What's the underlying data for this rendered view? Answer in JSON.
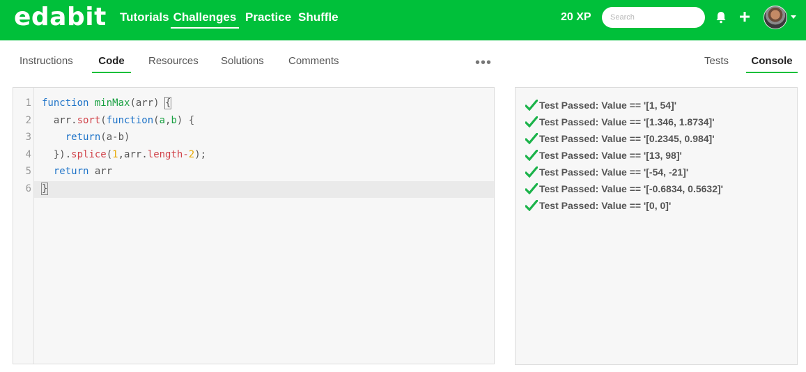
{
  "navbar": {
    "logo": "edabit",
    "links": [
      "Tutorials",
      "Challenges",
      "Practice",
      "Shuffle"
    ],
    "active_link": "Challenges",
    "xp": "20 XP",
    "search_placeholder": "Search",
    "icons": [
      "bell-icon",
      "plus-icon",
      "avatar",
      "chevron-down-icon"
    ]
  },
  "tabs": {
    "left": [
      "Instructions",
      "Code",
      "Resources",
      "Solutions",
      "Comments"
    ],
    "active_left": "Code",
    "more": "•••",
    "right": [
      "Tests",
      "Console"
    ],
    "active_right": "Console"
  },
  "editor": {
    "line_numbers": [
      "1",
      "2",
      "3",
      "4",
      "5",
      "6"
    ],
    "lines": [
      "function minMax(arr) {",
      "  arr.sort(function(a,b) {",
      "    return(a-b)",
      "  }).splice(1,arr.length-2);",
      "  return arr",
      "}"
    ]
  },
  "console": {
    "results": [
      "Test Passed: Value == '[1, 54]'",
      "Test Passed: Value == '[1.346, 1.8734]'",
      "Test Passed: Value == '[0.2345, 0.984]'",
      "Test Passed: Value == '[13, 98]'",
      "Test Passed: Value == '[-54, -21]'",
      "Test Passed: Value == '[-0.6834, 0.5632]'",
      "Test Passed: Value == '[0, 0]'"
    ]
  },
  "colors": {
    "brand": "#00c03a",
    "check": "#1bb34a",
    "keyword": "#1e73c8",
    "function": "#18a041",
    "method": "#d1434a",
    "number": "#e6a700"
  }
}
